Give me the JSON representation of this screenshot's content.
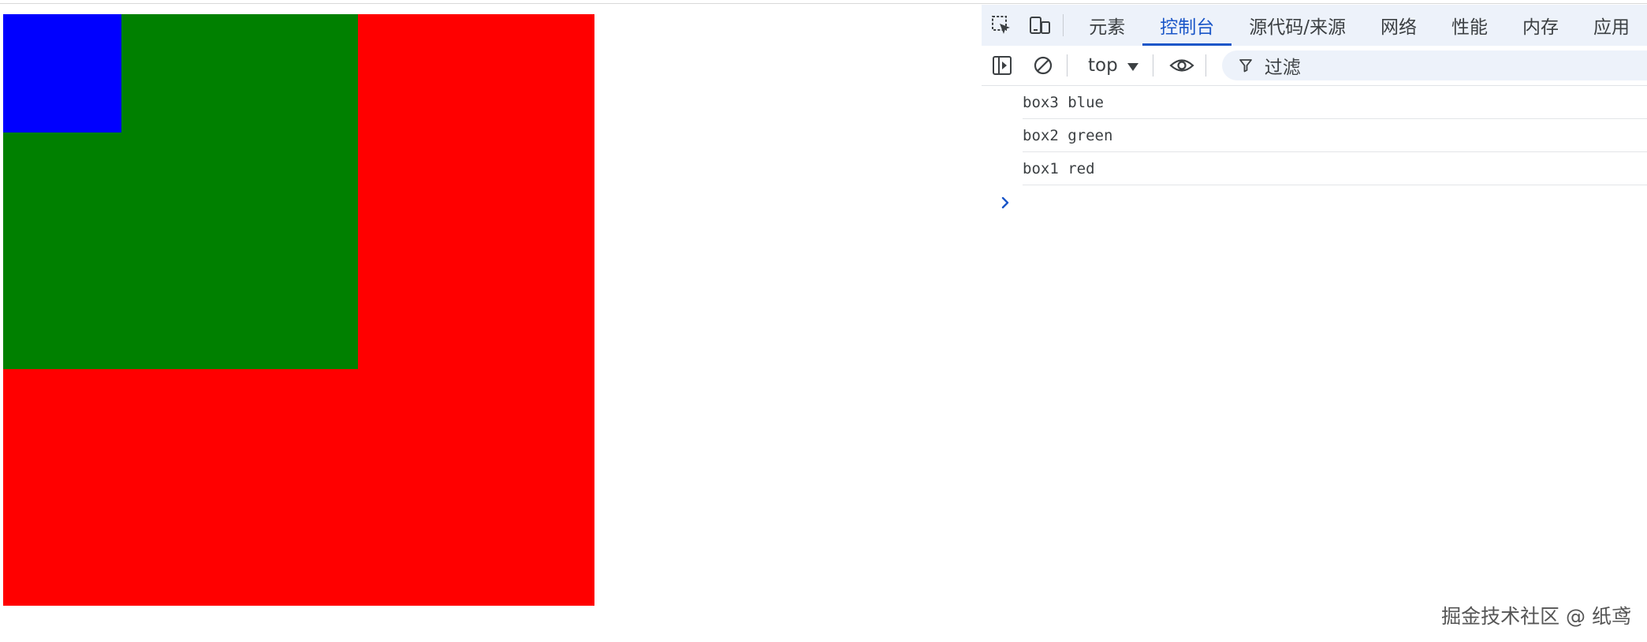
{
  "page": {
    "box1": {
      "label": "box1",
      "color": "#ff0000"
    },
    "box2": {
      "label": "box2",
      "color": "#008000"
    },
    "box3": {
      "label": "box3",
      "color": "#0000ff"
    }
  },
  "devtools": {
    "tabs": [
      {
        "label": "元素",
        "active": false
      },
      {
        "label": "控制台",
        "active": true
      },
      {
        "label": "源代码/来源",
        "active": false
      },
      {
        "label": "网络",
        "active": false
      },
      {
        "label": "性能",
        "active": false
      },
      {
        "label": "内存",
        "active": false
      },
      {
        "label": "应用",
        "active": false
      }
    ],
    "toolbar": {
      "context": "top",
      "filter_label": "过滤"
    },
    "console": {
      "messages": [
        {
          "text": "box3 blue"
        },
        {
          "text": "box2 green"
        },
        {
          "text": "box1 red"
        }
      ]
    },
    "accent": "#1a56c8"
  },
  "watermark": "掘金技术社区 @ 纸鸢"
}
